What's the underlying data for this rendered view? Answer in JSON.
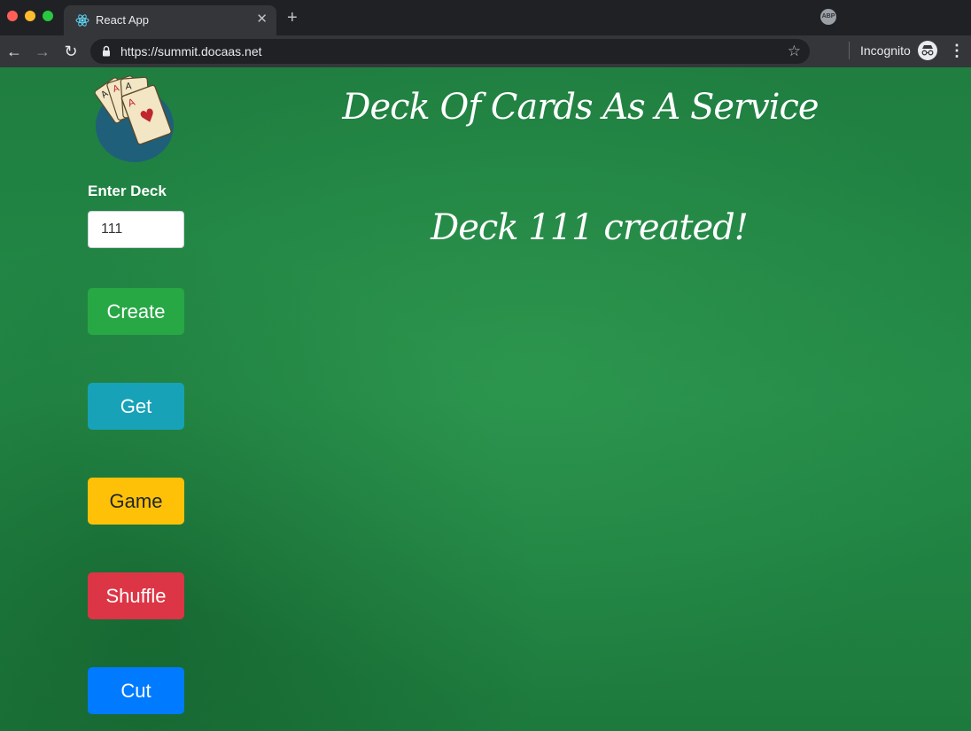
{
  "browser": {
    "tab_title": "React App",
    "url": "https://summit.docaas.net",
    "incognito_label": "Incognito",
    "abp_label": "ABP",
    "icons": {
      "back": "arrow-left-icon",
      "forward": "arrow-right-icon",
      "reload": "reload-icon",
      "lock": "lock-icon",
      "bookmark": "star-icon",
      "close_tab": "close-icon",
      "new_tab": "plus-icon",
      "menu": "kebab-menu-icon"
    }
  },
  "app": {
    "title": "Deck Of Cards As A Service",
    "status_message": "Deck 111 created!",
    "sidebar": {
      "enter_label": "Enter Deck",
      "deck_value": "111",
      "buttons": {
        "create": "Create",
        "get": "Get",
        "game": "Game",
        "shuffle": "Shuffle",
        "cut": "Cut"
      }
    },
    "colors": {
      "felt": "#1f7e40",
      "create": "#28a745",
      "get": "#17a2b8",
      "game": "#ffc107",
      "shuffle": "#dc3545",
      "cut": "#007bff"
    }
  }
}
